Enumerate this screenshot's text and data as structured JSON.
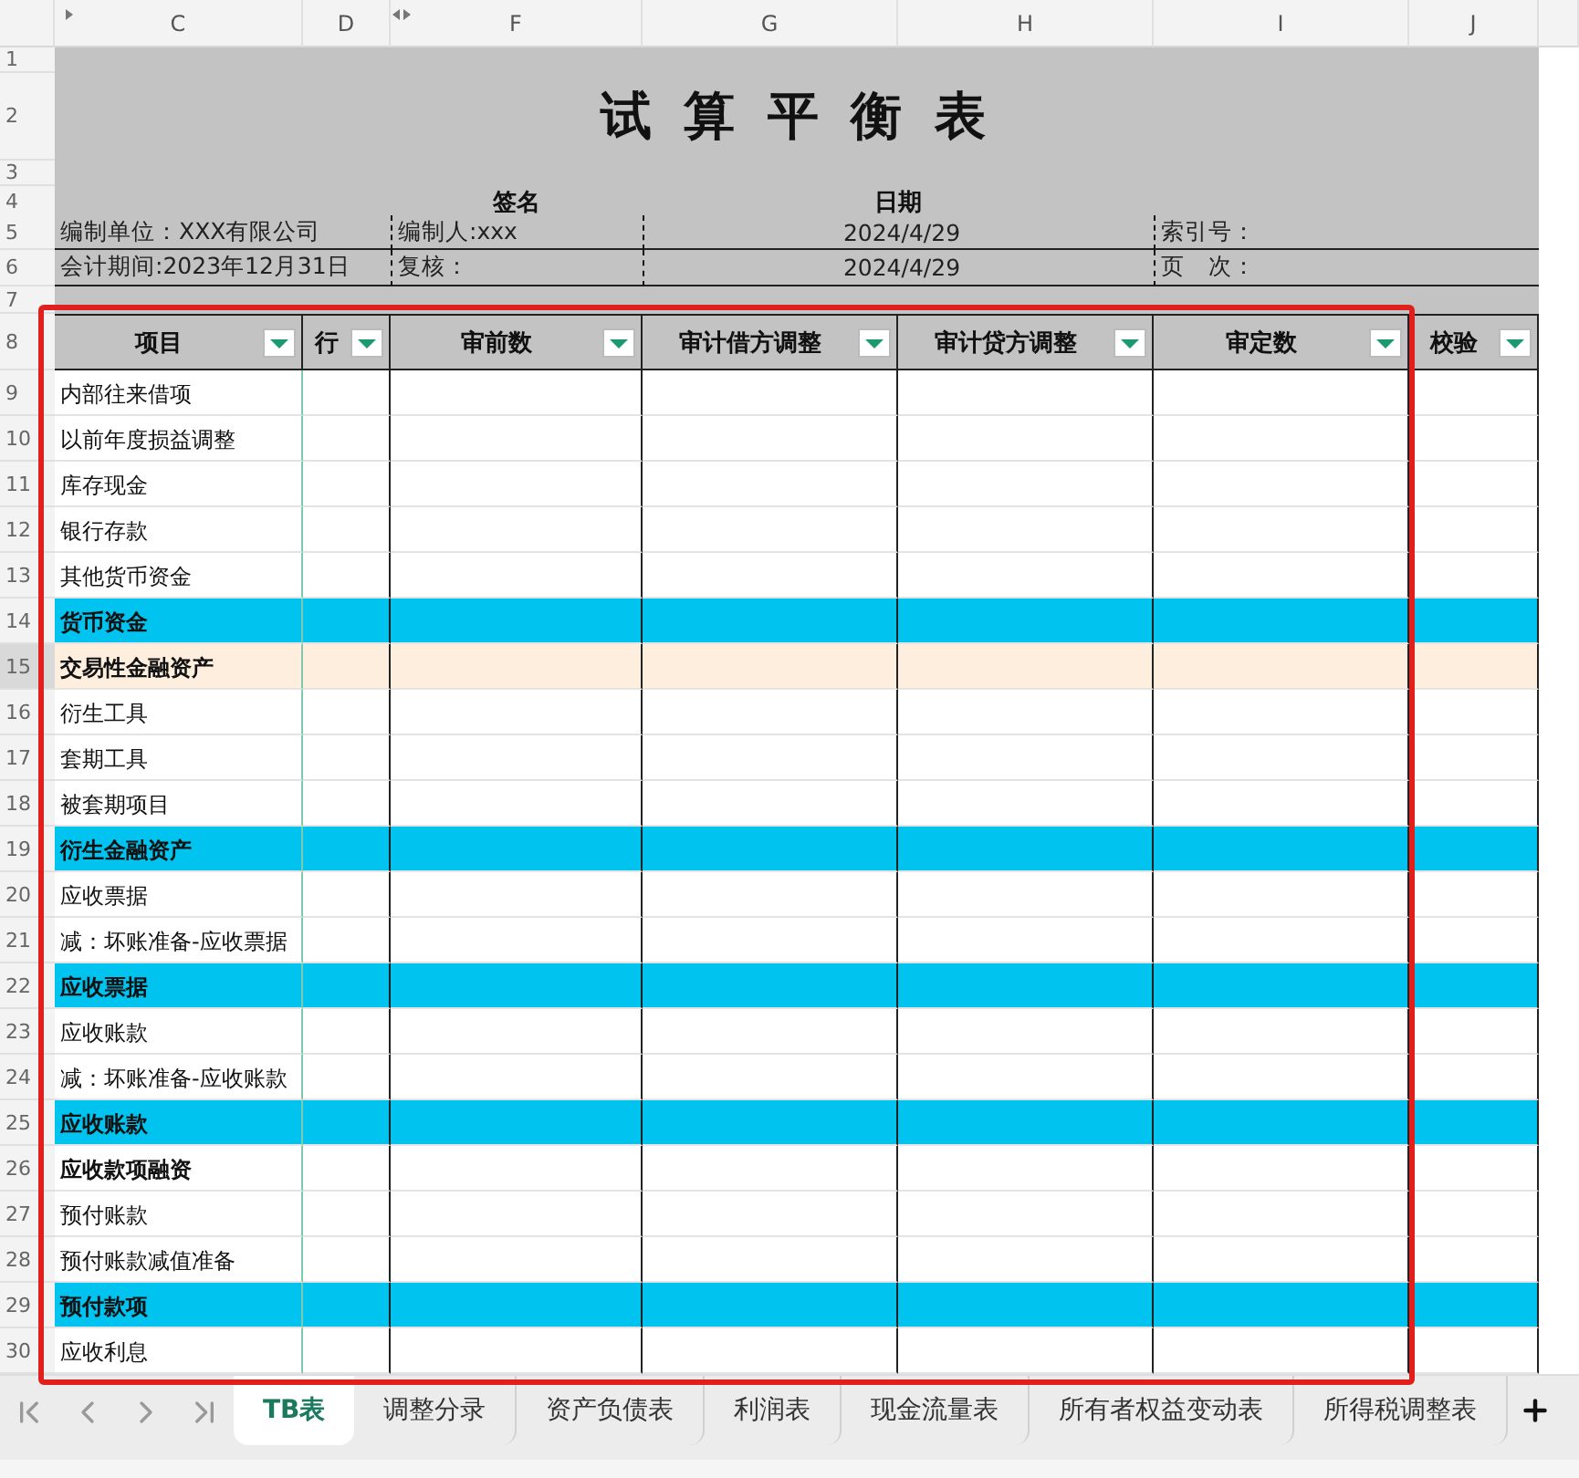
{
  "column_headers": [
    {
      "letter": "C"
    },
    {
      "letter": "D"
    },
    {
      "letter": "F"
    },
    {
      "letter": "G"
    },
    {
      "letter": "H"
    },
    {
      "letter": "I"
    },
    {
      "letter": "J"
    }
  ],
  "top_row_numbers": [
    "1",
    "2",
    "3",
    "4",
    "5",
    "6",
    "7",
    "8"
  ],
  "title": "试 算 平 衡 表",
  "signature_label": "签名",
  "date_label": "日期",
  "info_rows": [
    {
      "left": "编制单位：XXX有限公司",
      "person": "编制人:xxx",
      "date": "2024/4/29",
      "right": "索引号："
    },
    {
      "left": "会计期间:2023年12月31日",
      "person": "复核：",
      "date": "2024/4/29",
      "right": "页　次："
    }
  ],
  "table_headers": [
    {
      "label": "项目"
    },
    {
      "label": "行"
    },
    {
      "label": "审前数"
    },
    {
      "label": "审计借方调整"
    },
    {
      "label": "审计贷方调整"
    },
    {
      "label": "审定数"
    },
    {
      "label": "校验"
    }
  ],
  "rows": [
    {
      "number": "9",
      "item": "内部往来借项",
      "kind": "detail",
      "selected": false
    },
    {
      "number": "10",
      "item": "以前年度损益调整",
      "kind": "detail",
      "selected": false
    },
    {
      "number": "11",
      "item": "库存现金",
      "kind": "detail",
      "selected": false
    },
    {
      "number": "12",
      "item": "银行存款",
      "kind": "detail",
      "selected": false
    },
    {
      "number": "13",
      "item": "其他货币资金",
      "kind": "detail",
      "selected": false
    },
    {
      "number": "14",
      "item": "货币资金",
      "kind": "subtotal",
      "selected": false
    },
    {
      "number": "15",
      "item": "交易性金融资产",
      "kind": "heading",
      "selected": true
    },
    {
      "number": "16",
      "item": "衍生工具",
      "kind": "detail",
      "selected": false
    },
    {
      "number": "17",
      "item": "套期工具",
      "kind": "detail",
      "selected": false
    },
    {
      "number": "18",
      "item": "被套期项目",
      "kind": "detail",
      "selected": false
    },
    {
      "number": "19",
      "item": "衍生金融资产",
      "kind": "subtotal",
      "selected": false
    },
    {
      "number": "20",
      "item": "应收票据",
      "kind": "detail",
      "selected": false
    },
    {
      "number": "21",
      "item": "减：坏账准备-应收票据",
      "kind": "detail",
      "selected": false
    },
    {
      "number": "22",
      "item": "应收票据",
      "kind": "subtotal",
      "selected": false
    },
    {
      "number": "23",
      "item": "应收账款",
      "kind": "detail",
      "selected": false
    },
    {
      "number": "24",
      "item": "减：坏账准备-应收账款",
      "kind": "detail",
      "selected": false
    },
    {
      "number": "25",
      "item": "应收账款",
      "kind": "subtotal",
      "selected": false
    },
    {
      "number": "26",
      "item": "应收款项融资",
      "kind": "heading",
      "selected": false
    },
    {
      "number": "27",
      "item": "预付账款",
      "kind": "detail",
      "selected": false
    },
    {
      "number": "28",
      "item": "预付账款减值准备",
      "kind": "detail",
      "selected": false
    },
    {
      "number": "29",
      "item": "预付款项",
      "kind": "subtotal",
      "selected": false
    },
    {
      "number": "30",
      "item": "应收利息",
      "kind": "detail",
      "selected": false
    }
  ],
  "sheet_tabs": [
    {
      "label": "TB表",
      "selected": true
    },
    {
      "label": "调整分录",
      "selected": false
    },
    {
      "label": "资产负债表",
      "selected": false
    },
    {
      "label": "利润表",
      "selected": false
    },
    {
      "label": "现金流量表",
      "selected": false
    },
    {
      "label": "所有者权益变动表",
      "selected": false
    },
    {
      "label": "所得税调整表",
      "selected": false
    }
  ]
}
